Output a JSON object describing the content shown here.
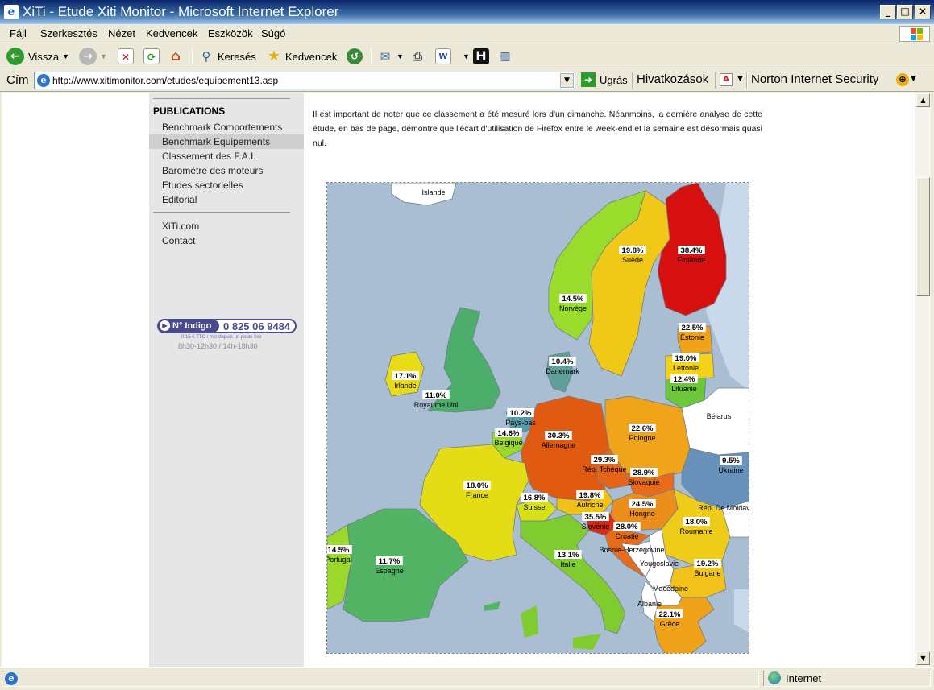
{
  "window": {
    "title": "XiTi - Etude Xiti Monitor - Microsoft Internet Explorer",
    "minimize": "_",
    "maximize": "□",
    "close": "×"
  },
  "menu": [
    "Fájl",
    "Szerkesztés",
    "Nézet",
    "Kedvencek",
    "Eszközök",
    "Súgó"
  ],
  "toolbar": {
    "back_label": "Vissza",
    "search_label": "Keresés",
    "favorites_label": "Kedvencek"
  },
  "address": {
    "label": "Cím",
    "url": "http://www.xitimonitor.com/etudes/equipement13.asp",
    "go_label": "Ugrás",
    "links_label": "Hivatkozások",
    "norton_label": "Norton Internet Security"
  },
  "sidebar": {
    "section_title": "PUBLICATIONS",
    "items": [
      {
        "label": "Benchmark Comportements",
        "active": false
      },
      {
        "label": "Benchmark Equipements",
        "active": true
      },
      {
        "label": "Classement des F.A.I.",
        "active": false
      },
      {
        "label": "Baromètre des moteurs",
        "active": false
      },
      {
        "label": "Etudes sectorielles",
        "active": false
      },
      {
        "label": "Editorial",
        "active": false
      }
    ],
    "links": [
      {
        "label": "XiTi.com"
      },
      {
        "label": "Contact"
      }
    ],
    "indigo": {
      "badge": "N° Indigo",
      "number": "0 825 06 9484",
      "subtext": "0,15 € TTC / min depuis un poste fixe",
      "hours": "8h30-12h30 / 14h-18h30"
    }
  },
  "article": {
    "text": "Il est important de noter que ce classement a été mesuré lors d'un dimanche. Néanmoins, la dernière analyse de cette étude, en bas de page, démontre que l'écart d'utilisation de Firefox entre le week-end et la semaine est désormais quasi nul."
  },
  "map": {
    "colors": {
      "sea": "#a9bed3",
      "no_data": "#ffffff",
      "label_bg": "#ffffff"
    },
    "countries": [
      {
        "name": "Islande",
        "value": ""
      },
      {
        "name": "Finlande",
        "value": "38.4%",
        "color": "#d60f0f"
      },
      {
        "name": "Suède",
        "value": "19.8%",
        "color": "#f0c818"
      },
      {
        "name": "Norvège",
        "value": "14.5%",
        "color": "#9adc2c"
      },
      {
        "name": "Estonie",
        "value": "22.5%",
        "color": "#f0a21a"
      },
      {
        "name": "Lettonie",
        "value": "19.0%",
        "color": "#f4d21a"
      },
      {
        "name": "Lituanie",
        "value": "12.4%",
        "color": "#6cc83a"
      },
      {
        "name": "Danemark",
        "value": "10.4%",
        "color": "#60a09a"
      },
      {
        "name": "Irlande",
        "value": "17.1%",
        "color": "#e8dc18"
      },
      {
        "name": "Royaume Uni",
        "value": "11.0%",
        "color": "#4cae6a"
      },
      {
        "name": "Pays-bas",
        "value": "10.2%",
        "color": "#5a9aa8"
      },
      {
        "name": "Belgique",
        "value": "14.6%",
        "color": "#9ad82c"
      },
      {
        "name": "Allemagne",
        "value": "30.3%",
        "color": "#e05a12"
      },
      {
        "name": "Pologne",
        "value": "22.6%",
        "color": "#f0a41a"
      },
      {
        "name": "Bélarus",
        "value": ""
      },
      {
        "name": "Ukraine",
        "value": "9.5%",
        "color": "#6892bc"
      },
      {
        "name": "Rép. Tchèque",
        "value": "29.3%",
        "color": "#e4641a"
      },
      {
        "name": "Slovaquie",
        "value": "28.9%",
        "color": "#e86a1a"
      },
      {
        "name": "France",
        "value": "18.0%",
        "color": "#e4dc14"
      },
      {
        "name": "Suisse",
        "value": "16.8%",
        "color": "#d8e018"
      },
      {
        "name": "Autriche",
        "value": "19.8%",
        "color": "#f0c218"
      },
      {
        "name": "Hongrie",
        "value": "24.5%",
        "color": "#ec8e1c"
      },
      {
        "name": "Rép. De Moldavie",
        "value": ""
      },
      {
        "name": "Roumanie",
        "value": "18.0%",
        "color": "#f0cc1a"
      },
      {
        "name": "Slovénie",
        "value": "35.5%",
        "color": "#d42a16"
      },
      {
        "name": "Croatie",
        "value": "28.0%",
        "color": "#e66c1a"
      },
      {
        "name": "Portugal",
        "value": "14.5%",
        "color": "#9ad82c"
      },
      {
        "name": "Espagne",
        "value": "11.7%",
        "color": "#52b464"
      },
      {
        "name": "Italie",
        "value": "13.1%",
        "color": "#80cc30"
      },
      {
        "name": "Bosnie-Herzégovine",
        "value": ""
      },
      {
        "name": "Yougoslavie",
        "value": ""
      },
      {
        "name": "Bulgarie",
        "value": "19.2%",
        "color": "#f0c21a"
      },
      {
        "name": "Macédoine",
        "value": ""
      },
      {
        "name": "Albanie",
        "value": ""
      },
      {
        "name": "Grèce",
        "value": "22.1%",
        "color": "#f0a21a"
      }
    ]
  },
  "status": {
    "zone_label": "Internet"
  }
}
